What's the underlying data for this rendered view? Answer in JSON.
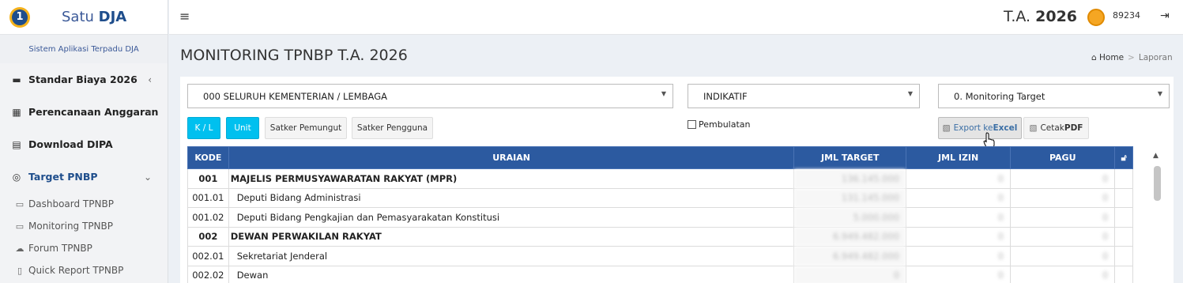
{
  "app": {
    "logo_badge": "1",
    "name_prefix": "Satu ",
    "name_bold": "DJA",
    "system_title": "Sistem Aplikasi Terpadu DJA"
  },
  "sidebar": {
    "menu": [
      {
        "label": "Standar Biaya 2026",
        "icon": "card-icon",
        "chevron": "‹"
      },
      {
        "label": "Perencanaan Anggaran",
        "icon": "calculator-icon",
        "chevron": "‹"
      },
      {
        "label": "Download DIPA",
        "icon": "file-icon",
        "chevron": ""
      },
      {
        "label": "Target PNBP",
        "icon": "target-icon",
        "chevron": "⌄"
      }
    ],
    "submenu": [
      {
        "label": "Dashboard TPNBP",
        "icon": "monitor-icon"
      },
      {
        "label": "Monitoring TPNBP",
        "icon": "monitor-icon"
      },
      {
        "label": "Forum TPNBP",
        "icon": "cloud-icon"
      },
      {
        "label": "Quick Report TPNBP",
        "icon": "document-icon"
      }
    ]
  },
  "topbar": {
    "ta_prefix": "T.A. ",
    "ta_year": "2026",
    "user_id": "89234"
  },
  "page": {
    "title": "MONITORING TPNBP T.A. 2026",
    "breadcrumb": [
      "Home",
      "Laporan"
    ]
  },
  "filters": {
    "kementerian": "000 SELURUH KEMENTERIAN / LEMBAGA",
    "jenis": "INDIKATIF",
    "laporan": "0. Monitoring Target",
    "pembulatan_label": "Pembulatan"
  },
  "buttons": {
    "kl": "K / L",
    "unit": "Unit",
    "satker_pemungut": "Satker Pemungut",
    "satker_pengguna": "Satker Pengguna",
    "export_prefix": "Export ke ",
    "export_bold": "Excel",
    "pdf_prefix": "Cetak ",
    "pdf_bold": "PDF"
  },
  "table": {
    "headers": [
      "KODE",
      "URAIAN",
      "JML TARGET",
      "JML IZIN",
      "PAGU"
    ],
    "rows": [
      {
        "level": 1,
        "kode": "001",
        "uraian": "MAJELIS PERMUSYAWARATAN RAKYAT (MPR)",
        "target": "136.145.000",
        "izin": "0",
        "pagu": "0"
      },
      {
        "level": 2,
        "kode": "001.01",
        "uraian": "Deputi Bidang Administrasi",
        "target": "131.145.000",
        "izin": "0",
        "pagu": "0"
      },
      {
        "level": 2,
        "kode": "001.02",
        "uraian": "Deputi Bidang Pengkajian dan Pemasyarakatan Konstitusi",
        "target": "5.000.000",
        "izin": "0",
        "pagu": "0"
      },
      {
        "level": 1,
        "kode": "002",
        "uraian": "DEWAN PERWAKILAN RAKYAT",
        "target": "6.949.482.000",
        "izin": "0",
        "pagu": "0"
      },
      {
        "level": 2,
        "kode": "002.01",
        "uraian": "Sekretariat Jenderal",
        "target": "6.949.482.000",
        "izin": "0",
        "pagu": "0"
      },
      {
        "level": 2,
        "kode": "002.02",
        "uraian": "Dewan",
        "target": "0",
        "izin": "0",
        "pagu": "0"
      }
    ]
  }
}
